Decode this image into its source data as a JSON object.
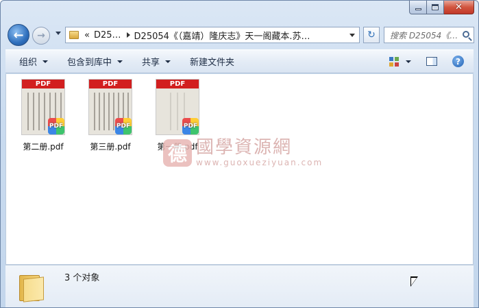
{
  "window": {
    "controls": {
      "minimize_icon": "minimize-icon",
      "maximize_icon": "maximize-icon",
      "close_icon": "close-icon"
    }
  },
  "nav": {
    "back_glyph": "←",
    "forward_glyph": "→",
    "address": {
      "overflow": "«",
      "segment1": "D25…",
      "segment2": "D25054《（嘉靖）隆庆志》天一阁藏本.苏…"
    },
    "refresh_glyph": "↻",
    "search_placeholder": "搜索 D25054《…"
  },
  "toolbar": {
    "organize": "组织",
    "include_library": "包含到库中",
    "share": "共享",
    "new_folder": "新建文件夹",
    "help_glyph": "?"
  },
  "files": [
    {
      "name": "第二册.pdf",
      "badge": "PDF",
      "header": "PDF"
    },
    {
      "name": "第三册.pdf",
      "badge": "PDF",
      "header": "PDF"
    },
    {
      "name": "第一册.pdf",
      "badge": "PDF",
      "header": "PDF"
    }
  ],
  "watermark": {
    "seal": "德",
    "title": "國學資源網",
    "url": "www.guoxueziyuan.com"
  },
  "details": {
    "count": "3 个对象"
  },
  "colors": {
    "pdf_red": "#d21f1f",
    "accent_blue": "#2e6fbd"
  }
}
